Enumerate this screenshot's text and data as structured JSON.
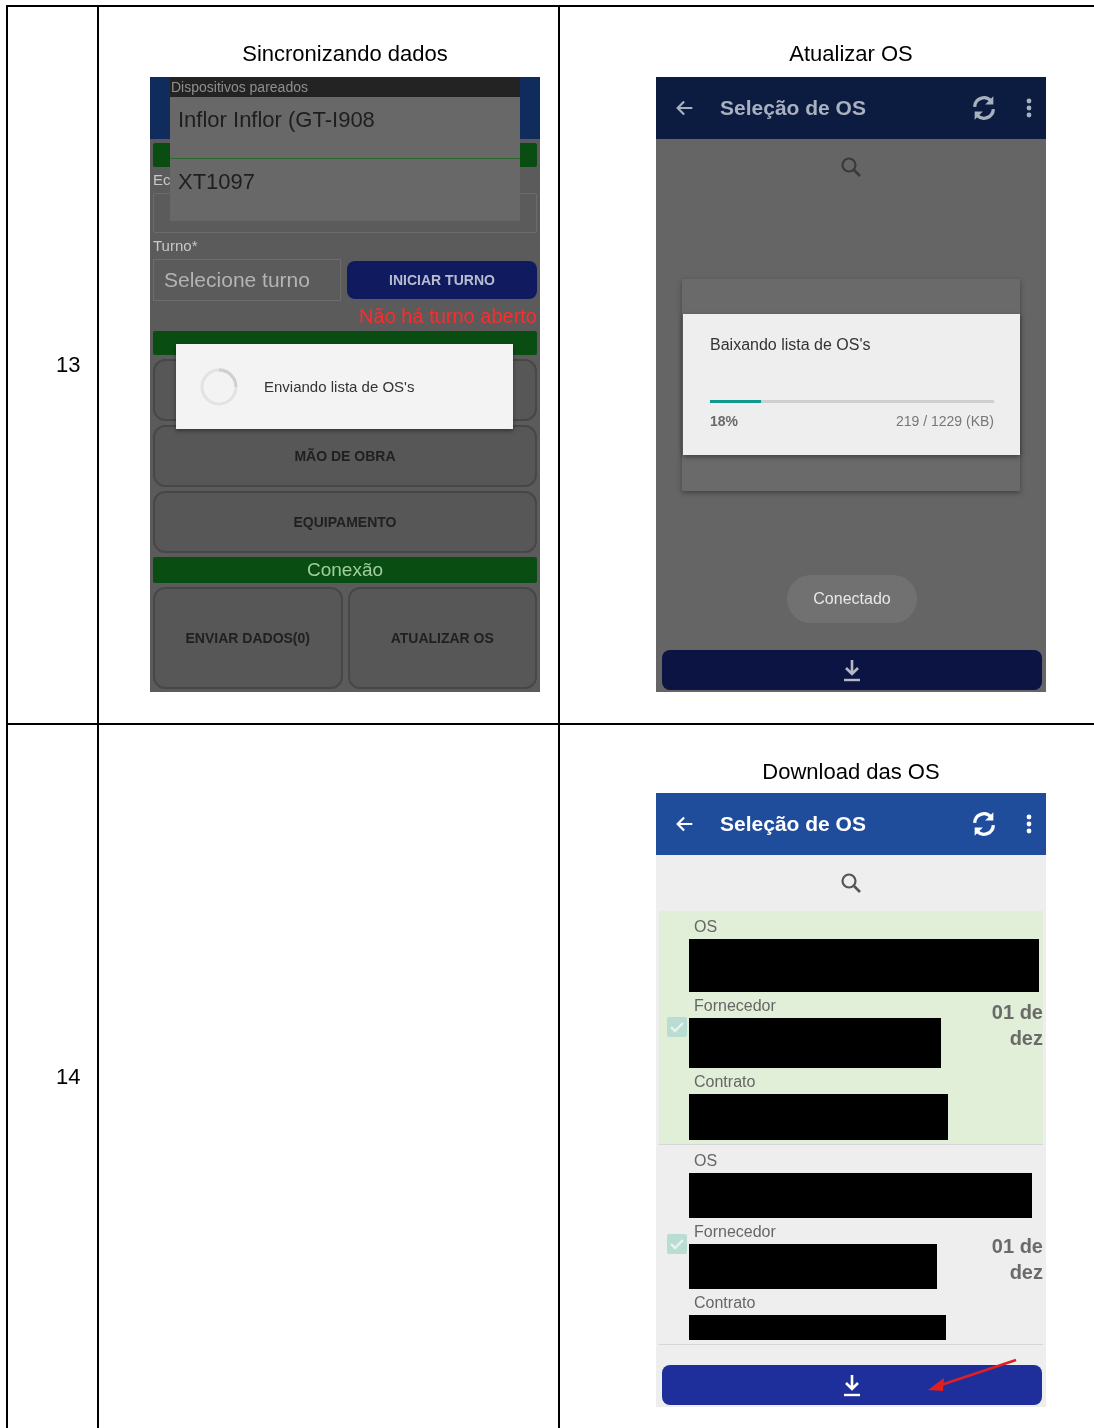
{
  "document_table": {
    "rows": [
      {
        "number": "13",
        "left": {
          "caption": "Sincronizando dados",
          "screen": {
            "kind": "shift_form",
            "paired_devices": {
              "title": "Dispositivos pareados",
              "devices": [
                "Inflor Inflor (GT-I908",
                "XT1097"
              ]
            },
            "field_label": "Ec",
            "shift_label": "Turno*",
            "shift_placeholder": "Selecione turno",
            "start_button": "INICIAR TURNO",
            "shift_message": "Não há turno aberto",
            "buttons": [
              "MÃO DE OBRA",
              "EQUIPAMENTO"
            ],
            "section_label": "Conexão",
            "bottom_buttons": [
              "ENVIAR DADOS(0)",
              "ATUALIZAR OS"
            ],
            "dialog": {
              "message": "Enviando lista de OS's"
            }
          }
        },
        "right": {
          "caption": "Atualizar OS",
          "screen": {
            "kind": "download_progress",
            "title": "Seleção de OS",
            "dialog": {
              "message": "Baixando lista de OS's",
              "level": 0.18,
              "percent": "18%",
              "amount": "219 / 1229 (KB)"
            },
            "toast": "Conectado"
          }
        }
      },
      {
        "number": "14",
        "right": {
          "caption": "Download das OS",
          "screen": {
            "kind": "os_list",
            "title": "Seleção de OS",
            "items": [
              {
                "selected": true,
                "checked": true,
                "date": "01 de dez",
                "fields": [
                  {
                    "label": "OS",
                    "redacted": true
                  },
                  {
                    "label": "Fornecedor",
                    "redacted": true
                  },
                  {
                    "label": "Contrato",
                    "redacted": true
                  }
                ]
              },
              {
                "selected": false,
                "checked": true,
                "date": "01 de dez",
                "fields": [
                  {
                    "label": "OS",
                    "redacted": true
                  },
                  {
                    "label": "Fornecedor",
                    "redacted": true
                  },
                  {
                    "label": "Contrato",
                    "redacted": true
                  }
                ]
              }
            ],
            "annotations": [
              {
                "kind": "arrow"
              }
            ]
          }
        }
      }
    ]
  }
}
